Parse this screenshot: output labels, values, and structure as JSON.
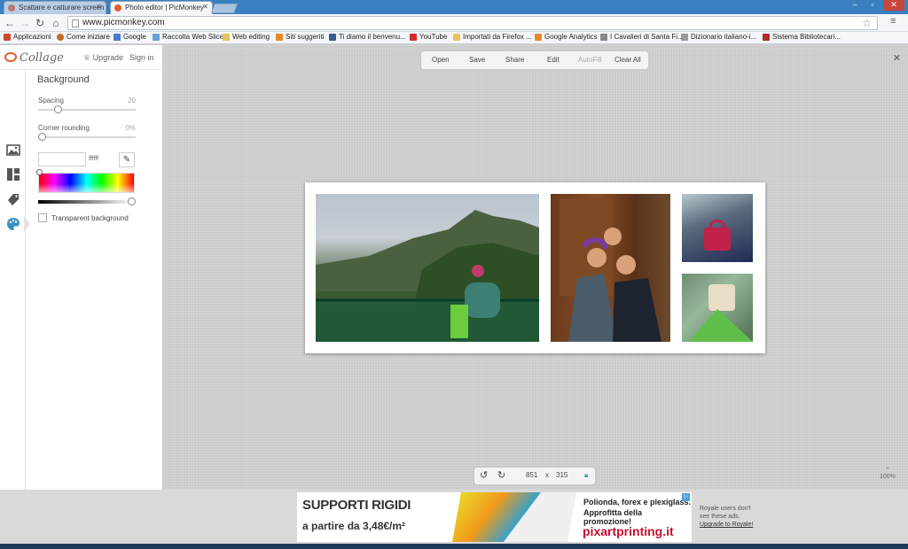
{
  "browser": {
    "tabs": [
      {
        "title": "Scattare e catturare screen",
        "active": false
      },
      {
        "title": "Photo editor | PicMonkey",
        "active": true
      }
    ],
    "url": "www.picmonkey.com",
    "bookmarks": [
      "Applicazioni",
      "Come iniziare",
      "Google",
      "Raccolta Web Slice",
      "Web editing",
      "Siti suggeriti",
      "Ti diamo il benvenu...",
      "YouTube",
      "Importati da Firefox ...",
      "Google Analytics",
      "I Cavalieri di Santa Fi...",
      "Dizionario italiano-i...",
      "Sistema Bibliotecari..."
    ],
    "icons": {
      "back": "back-arrow-icon",
      "forward": "forward-arrow-icon",
      "reload": "reload-icon",
      "home": "home-icon",
      "star": "star-icon",
      "menu": "hamburger-menu-icon"
    }
  },
  "app": {
    "logo_text": "Collage",
    "upgrade": "Upgrade",
    "sign_in": "Sign in",
    "panel": {
      "title": "Background",
      "spacing_label": "Spacing",
      "spacing_value": "20",
      "spacing_fraction": 0.2,
      "corner_label": "Corner rounding",
      "corner_value": "0%",
      "corner_fraction": 0,
      "hex_value": "ffffff",
      "transparent_label": "Transparent background",
      "transparent_checked": false
    },
    "rail_icons": [
      "images-icon",
      "layouts-icon",
      "stickers-icon",
      "palette-icon"
    ],
    "menu": [
      "Open",
      "Save",
      "Share",
      "Edit",
      "AutoFill",
      "Clear All"
    ],
    "menu_disabled": [
      "AutoFill"
    ],
    "canvas_size": {
      "width": "851",
      "x_sep": "x",
      "height": "315"
    },
    "zoom": "100%"
  },
  "ad": {
    "headline": "SUPPORTI RIGIDI",
    "price_line": "a partire da 3,48€/m²",
    "right_line1": "Polionda, forex e plexiglass.",
    "right_line2": "Approfitta della promozione!",
    "brand": "pixartprinting.it",
    "note_line1": "Royale users don't",
    "note_line2": "see these ads.",
    "note_link": "Upgrade to Royale!"
  },
  "colors": {
    "tabbar": "#3a7fc0",
    "accent": "#3b8fc6",
    "logo": "#e0612b",
    "brand_red": "#c8102e"
  }
}
